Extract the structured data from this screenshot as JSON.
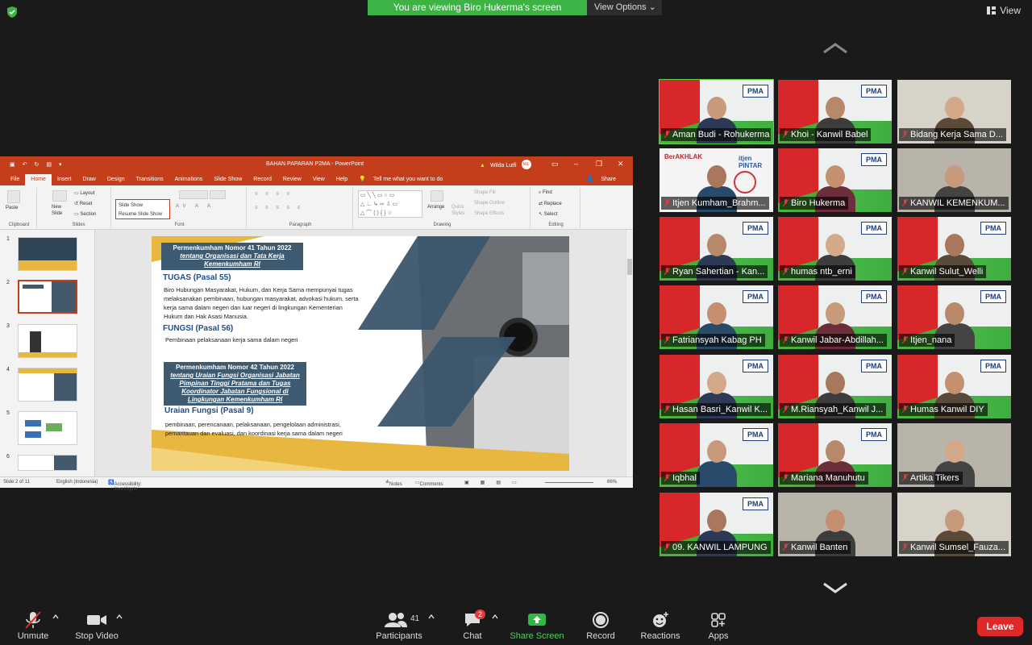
{
  "banner": {
    "message": "You are viewing Biro Hukerma's screen",
    "options": "View Options"
  },
  "view_button": "View",
  "ppt": {
    "doc_title": "BAHAN PAPARAN P2MA  -  PowerPoint",
    "user_name": "Wilda Lutfi",
    "user_initials": "WL",
    "tabs": [
      "File",
      "Home",
      "Insert",
      "Draw",
      "Design",
      "Transitions",
      "Animations",
      "Slide Show",
      "Record",
      "Review",
      "View",
      "Help"
    ],
    "tell_me": "Tell me what you want to do",
    "share": "Share",
    "groups": {
      "clipboard": "Clipboard",
      "slides": "Slides",
      "font": "Font",
      "paragraph": "Paragraph",
      "drawing": "Drawing",
      "editing": "Editing"
    },
    "ribbon": {
      "paste": "Paste",
      "new_slide": "New Slide",
      "layout": "Layout",
      "reset": "Reset",
      "section": "Section",
      "slideshow_menu": [
        "Slide Show",
        "Resume Slide Show"
      ],
      "arrange": "Arrange",
      "quick_styles": "Quick Styles",
      "shape_fill": "Shape Fill",
      "shape_outline": "Shape Outline",
      "shape_effects": "Shape Effects",
      "find": "Find",
      "replace": "Replace",
      "select": "Select"
    },
    "thumb_numbers": [
      "1",
      "2",
      "3",
      "4",
      "5",
      "6"
    ],
    "slide": {
      "head1": [
        "Permenkumham Nomor 41 Tahun 2022",
        "tentang Organisasi dan Tata Kerja",
        "Kemenkumham RI"
      ],
      "tugas_title": "TUGAS (Pasal 55)",
      "tugas_body": "Biro Hubungan Masyarakat, Hukum, dan Kerja Sama mempunyai tugas melaksanakan pembinaan, hubungan masyarakat, advokasi hukum, serta kerja sama dalam negeri dan luar negeri di lingkungan Kementerian Hukum dan Hak Asasi Manusia.",
      "fungsi_title": "FUNGSI (Pasal 56)",
      "fungsi_body": "Pembinaan pelaksanaan kerja sama dalam negeri",
      "head2": [
        "Permenkumham Nomor 42 Tahun 2022",
        "tentang Uraian Fungsi Organisasi Jabatan",
        "Pimpinan Tinggi Pratama dan Tugas",
        "Koordinator Jabatan Fungsional di",
        "Lingkungan Kemenkumham RI"
      ],
      "uraian_title": "Uraian Fungsi (Pasal 9)",
      "uraian_body": "pembinaan, perencanaan, pelaksanaan, pengelolaan administrasi, pemantauan dan evaluasi, dan koordinasi kerja sama dalam negeri"
    },
    "status": {
      "slide_of": "Slide 2 of 11",
      "language": "English (Indonesia)",
      "accessibility": "Accessibility: Investigate",
      "notes": "Notes",
      "comments": "Comments",
      "zoom": "66%"
    }
  },
  "participants_tiles": [
    {
      "name": "Aman Budi - Rohukerma",
      "style": "pma",
      "speaking": true
    },
    {
      "name": "Khoi - Kanwil Babel",
      "style": "pma"
    },
    {
      "name": "Bidang Kerja Sama D...",
      "style": "room"
    },
    {
      "name": "Itjen Kumham_Brahm...",
      "style": "slide"
    },
    {
      "name": "Biro Hukerma",
      "style": "pma"
    },
    {
      "name": "KANWIL KEMENKUM...",
      "style": "room"
    },
    {
      "name": "Ryan Sahertian - Kan...",
      "style": "pma"
    },
    {
      "name": "humas ntb_erni",
      "style": "pma"
    },
    {
      "name": "Kanwil Sulut_Welli",
      "style": "pma"
    },
    {
      "name": "Fatriansyah Kabag PH",
      "style": "pma2"
    },
    {
      "name": "Kanwil Jabar-Abdillah...",
      "style": "pma"
    },
    {
      "name": "Itjen_nana",
      "style": "pma"
    },
    {
      "name": "Hasan Basri_Kanwil K...",
      "style": "pma"
    },
    {
      "name": "M.Riansyah_Kanwil J...",
      "style": "pma"
    },
    {
      "name": "Humas Kanwil DIY",
      "style": "pma"
    },
    {
      "name": "Iqbhal",
      "style": "pma"
    },
    {
      "name": "Mariana Manuhutu",
      "style": "pma"
    },
    {
      "name": "Artika Tikers",
      "style": "room"
    },
    {
      "name": "09. KANWIL LAMPUNG",
      "style": "pma"
    },
    {
      "name": "Kanwil Banten",
      "style": "room"
    },
    {
      "name": "Kanwil Sumsel_Fauza...",
      "style": "room"
    }
  ],
  "slide_pma_label": "PMA",
  "itjen_slide_text": [
    "BerAKHLAK",
    "itjen PINTAR"
  ],
  "toolbar": {
    "unmute": "Unmute",
    "stop_video": "Stop Video",
    "participants": "Participants",
    "participants_count": "41",
    "chat": "Chat",
    "chat_badge": "2",
    "share_screen": "Share Screen",
    "record": "Record",
    "reactions": "Reactions",
    "apps": "Apps",
    "leave": "Leave"
  },
  "colors": {
    "banner_green": "#3db346",
    "ppt_red": "#c43e1c",
    "leave_red": "#e02828",
    "speaking_green": "#5ad544"
  }
}
